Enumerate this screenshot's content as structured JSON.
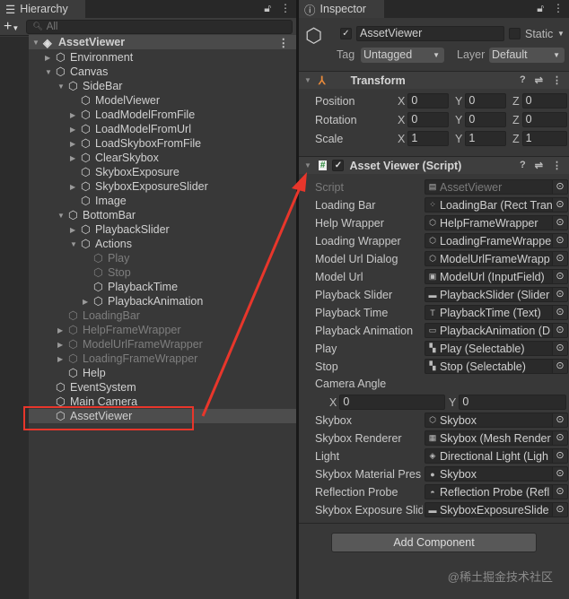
{
  "hierarchy": {
    "tab": "Hierarchy",
    "search_placeholder": "All",
    "root": "AssetViewer",
    "items": [
      {
        "label": "Environment",
        "level": 1,
        "expand": "closed",
        "inactive": false
      },
      {
        "label": "Canvas",
        "level": 1,
        "expand": "open",
        "inactive": false
      },
      {
        "label": "SideBar",
        "level": 2,
        "expand": "open",
        "inactive": false
      },
      {
        "label": "ModelViewer",
        "level": 3,
        "expand": "",
        "inactive": false
      },
      {
        "label": "LoadModelFromFile",
        "level": 3,
        "expand": "closed",
        "inactive": false
      },
      {
        "label": "LoadModelFromUrl",
        "level": 3,
        "expand": "closed",
        "inactive": false
      },
      {
        "label": "LoadSkyboxFromFile",
        "level": 3,
        "expand": "closed",
        "inactive": false
      },
      {
        "label": "ClearSkybox",
        "level": 3,
        "expand": "closed",
        "inactive": false
      },
      {
        "label": "SkyboxExposure",
        "level": 3,
        "expand": "",
        "inactive": false
      },
      {
        "label": "SkyboxExposureSlider",
        "level": 3,
        "expand": "closed",
        "inactive": false
      },
      {
        "label": "Image",
        "level": 3,
        "expand": "",
        "inactive": false
      },
      {
        "label": "BottomBar",
        "level": 2,
        "expand": "open",
        "inactive": false
      },
      {
        "label": "PlaybackSlider",
        "level": 3,
        "expand": "closed",
        "inactive": false
      },
      {
        "label": "Actions",
        "level": 3,
        "expand": "open",
        "inactive": false
      },
      {
        "label": "Play",
        "level": 4,
        "expand": "",
        "inactive": true
      },
      {
        "label": "Stop",
        "level": 4,
        "expand": "",
        "inactive": true
      },
      {
        "label": "PlaybackTime",
        "level": 4,
        "expand": "",
        "inactive": false
      },
      {
        "label": "PlaybackAnimation",
        "level": 4,
        "expand": "closed",
        "inactive": false
      },
      {
        "label": "LoadingBar",
        "level": 2,
        "expand": "",
        "inactive": true
      },
      {
        "label": "HelpFrameWrapper",
        "level": 2,
        "expand": "closed",
        "inactive": true
      },
      {
        "label": "ModelUrlFrameWrapper",
        "level": 2,
        "expand": "closed",
        "inactive": true
      },
      {
        "label": "LoadingFrameWrapper",
        "level": 2,
        "expand": "closed",
        "inactive": true
      },
      {
        "label": "Help",
        "level": 2,
        "expand": "",
        "inactive": false
      },
      {
        "label": "EventSystem",
        "level": 1,
        "expand": "",
        "inactive": false
      },
      {
        "label": "Main Camera",
        "level": 1,
        "expand": "",
        "inactive": false
      },
      {
        "label": "AssetViewer",
        "level": 1,
        "expand": "",
        "inactive": false,
        "selected": true
      }
    ]
  },
  "inspector": {
    "tab": "Inspector",
    "name": "AssetViewer",
    "static_label": "Static",
    "tag_label": "Tag",
    "tag": "Untagged",
    "layer_label": "Layer",
    "layer": "Default",
    "transform": {
      "title": "Transform",
      "rows": [
        {
          "label": "Position",
          "x": "0",
          "y": "0",
          "z": "0"
        },
        {
          "label": "Rotation",
          "x": "0",
          "y": "0",
          "z": "0"
        },
        {
          "label": "Scale",
          "x": "1",
          "y": "1",
          "z": "1"
        }
      ]
    },
    "script": {
      "title": "Asset Viewer (Script)",
      "fields": [
        {
          "label": "Script",
          "value": "AssetViewer",
          "icon": "script-icon",
          "disabled": true
        },
        {
          "label": "Loading Bar",
          "value": "LoadingBar (Rect Tran",
          "icon": "rect-transform-icon"
        },
        {
          "label": "Help Wrapper",
          "value": "HelpFrameWrapper",
          "icon": "gameobject-icon"
        },
        {
          "label": "Loading Wrapper",
          "value": "LoadingFrameWrappe",
          "icon": "gameobject-icon"
        },
        {
          "label": "Model Url Dialog",
          "value": "ModelUrlFrameWrapp",
          "icon": "gameobject-icon"
        },
        {
          "label": "Model Url",
          "value": "ModelUrl (InputField)",
          "icon": "inputfield-icon"
        },
        {
          "label": "Playback Slider",
          "value": "PlaybackSlider (Slider",
          "icon": "slider-icon"
        },
        {
          "label": "Playback Time",
          "value": "PlaybackTime (Text)",
          "icon": "text-icon"
        },
        {
          "label": "Playback Animation",
          "value": "PlaybackAnimation (D",
          "icon": "dropdown-icon"
        },
        {
          "label": "Play",
          "value": "Play (Selectable)",
          "icon": "selectable-icon"
        },
        {
          "label": "Stop",
          "value": "Stop (Selectable)",
          "icon": "selectable-icon"
        }
      ],
      "camera_angle": {
        "label": "Camera Angle",
        "x": "0",
        "y": "0"
      },
      "fields2": [
        {
          "label": "Skybox",
          "value": "Skybox",
          "icon": "gameobject-icon"
        },
        {
          "label": "Skybox Renderer",
          "value": "Skybox (Mesh Render",
          "icon": "mesh-renderer-icon"
        },
        {
          "label": "Light",
          "value": "Directional Light (Ligh",
          "icon": "light-icon"
        },
        {
          "label": "Skybox Material Pres",
          "value": "Skybox",
          "icon": "material-icon"
        },
        {
          "label": "Reflection Probe",
          "value": "Reflection Probe (Refl",
          "icon": "reflection-probe-icon"
        },
        {
          "label": "Skybox Exposure Slid",
          "value": "SkyboxExposureSlide",
          "icon": "slider-icon"
        }
      ]
    },
    "add_component": "Add Component"
  },
  "watermark": "@稀土掘金技术社区",
  "colors": {
    "annotation": "#e8362b"
  }
}
